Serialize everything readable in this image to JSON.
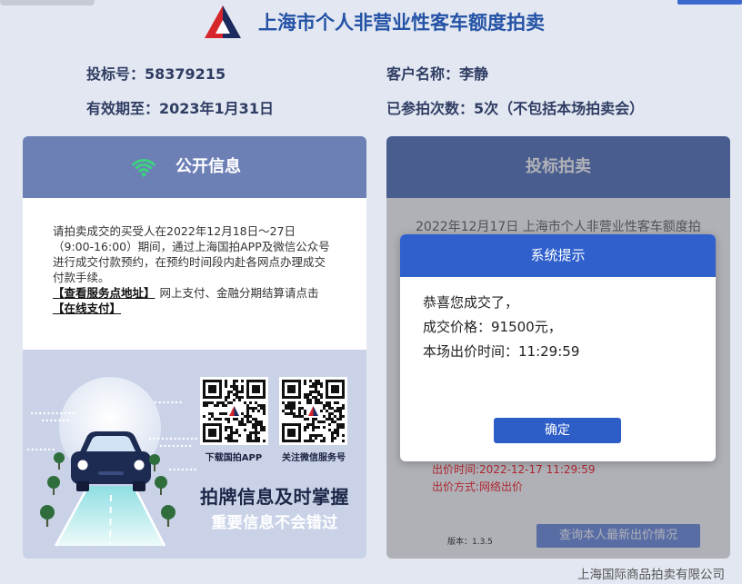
{
  "header": {
    "title": "上海市个人非营业性客车额度拍卖"
  },
  "account": {
    "bid_number_label": "投标号：",
    "bid_number": "58379215",
    "customer_name_label": "客户名称：",
    "customer_name": "李静",
    "valid_until_label": "有效期至：",
    "valid_until": "2023年1月31日",
    "auction_count_label": "已参拍次数：",
    "auction_count": "5次（不包括本场拍卖会）"
  },
  "public_info": {
    "title": "公开信息",
    "notice_lines": [
      "请拍卖成交的买受人在2022年12月18日～27日",
      "（9:00-16:00）期间，通过上海国拍APP及微信公众号",
      "进行成交付款预约，在预约时间段内赴各网点办理成交",
      "付款手续。"
    ],
    "service_link": "【查看服务点地址】",
    "payment_text": "网上支付、金融分期结算请点击",
    "payment_link": "【在线支付】",
    "qr_codes": [
      {
        "label": "下载国拍APP"
      },
      {
        "label": "关注微信服务号"
      }
    ],
    "slogan": "拍牌信息及时掌握",
    "sub_slogan": "重要信息不会错过"
  },
  "bidding": {
    "title": "投标拍卖",
    "auction_name": "2022年12月17日 上海市个人非营业性客车额度拍",
    "bid_time": "出价时间:2022-12-17 11:29:59",
    "bid_method": "出价方式:网络出价",
    "version": "版本：1.3.5",
    "query_button": "查询本人最新出价情况"
  },
  "modal": {
    "title": "系统提示",
    "lines": [
      "恭喜您成交了，",
      "成交价格：91500元，",
      "本场出价时间：11:29:59"
    ],
    "confirm_button": "确定"
  },
  "footer": {
    "company": "上海国际商品拍卖有限公司"
  },
  "icons": {
    "logo": "auction-logo-icon",
    "public_info_header": "wifi-icon",
    "illustration": "car-icon",
    "qr_center": "qr-logo-icon"
  },
  "colors": {
    "page_background": "#e2e7f1",
    "site_title": "#2453a6",
    "info_text": "#2f3d63",
    "public_info_header": "#6d80b6",
    "bidding_header": "#6780c4",
    "modal_header": "#2f60cc",
    "confirm_button": "#2d5dc6",
    "bid_detail_text": "#ff2d36",
    "wifi_icon": "#3dd17f",
    "logo_red": "#d7262b",
    "logo_navy": "#1c2a5e"
  }
}
